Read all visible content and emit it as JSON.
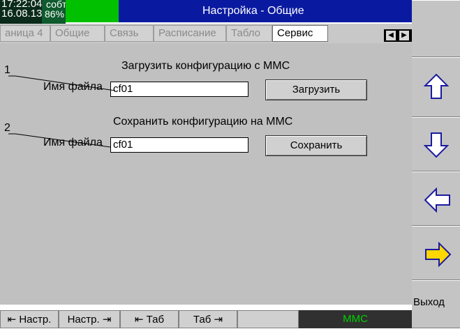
{
  "status": {
    "time": "17:22:04",
    "date": "16.08.13",
    "indicator": "собт",
    "battery": "86%"
  },
  "title": "Настройка - Общие",
  "tabs": [
    {
      "label": "аница 4",
      "active": false
    },
    {
      "label": "Общие",
      "active": false
    },
    {
      "label": "Связь",
      "active": false
    },
    {
      "label": "Расписание",
      "active": false
    },
    {
      "label": "Табло",
      "active": false
    },
    {
      "label": "Сервис",
      "active": true
    }
  ],
  "tab_scroll": {
    "left": "◀",
    "right": "▶"
  },
  "load": {
    "title": "Загрузить конфигурацию с MMC",
    "field_label": "Имя файла",
    "value": "cf01",
    "button": "Загрузить",
    "callout": "1"
  },
  "save": {
    "title": "Сохранить конфигурацию на MMC",
    "field_label": "Имя файла",
    "value": "cf01",
    "button": "Сохранить",
    "callout": "2"
  },
  "softkeys": {
    "up": "arrow-up-icon",
    "down": "arrow-down-icon",
    "left": "arrow-left-icon",
    "right": "arrow-right-icon",
    "exit": "Выход"
  },
  "bottom": {
    "prev_settings": "⇤ Настр.",
    "next_settings": "Настр. ⇥",
    "prev_tab": "⇤ Таб",
    "next_tab": "Таб ⇥",
    "mmc": "MMC"
  },
  "colors": {
    "title_bar": "#0a1aa0",
    "status_green": "#00c000",
    "mmc_text": "#00d000",
    "panel": "#c0c0c0"
  }
}
